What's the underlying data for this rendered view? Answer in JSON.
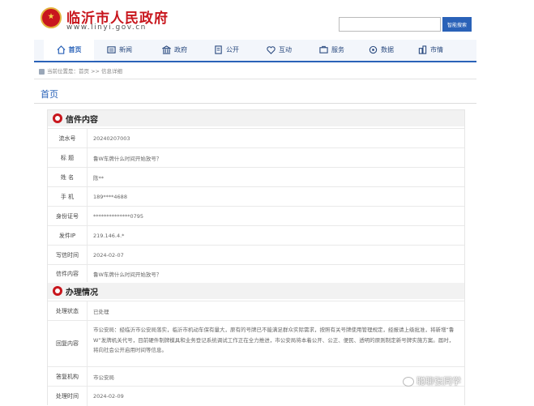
{
  "header": {
    "site_title": "临沂市人民政府",
    "site_url": "www.linyi.gov.cn",
    "search_placeholder": "",
    "search_button": "智能搜索"
  },
  "nav": [
    {
      "label": "首页",
      "icon": "home-icon"
    },
    {
      "label": "新闻",
      "icon": "news-icon"
    },
    {
      "label": "政府",
      "icon": "government-icon"
    },
    {
      "label": "公开",
      "icon": "document-icon"
    },
    {
      "label": "互动",
      "icon": "interaction-icon"
    },
    {
      "label": "服务",
      "icon": "service-icon"
    },
    {
      "label": "数据",
      "icon": "data-icon"
    },
    {
      "label": "市情",
      "icon": "city-icon"
    }
  ],
  "breadcrumb": {
    "prefix": "当前位置是：",
    "path": "首页  >>  信息详细"
  },
  "page_heading": "首页",
  "letter_section": {
    "title": "信件内容",
    "rows": [
      {
        "label": "流水号",
        "value": "20240207003"
      },
      {
        "label": "标    题",
        "value": "鲁W车牌什么时间开始放号？"
      },
      {
        "label": "姓    名",
        "value": "陈**"
      },
      {
        "label": "手    机",
        "value": "189****4688"
      },
      {
        "label": "身份证号",
        "value": "**************0795"
      },
      {
        "label": "发件IP",
        "value": "219.146.4.*"
      },
      {
        "label": "写信时间",
        "value": "2024-02-07"
      },
      {
        "label": "信件内容",
        "value": "鲁W车牌什么时间开始放号？"
      }
    ]
  },
  "handling_section": {
    "title": "办理情况",
    "rows": [
      {
        "label": "处理状态",
        "value": "已处理"
      },
      {
        "label": "回复内容",
        "value": "市公安局：经临沂市公安局落实，临沂市机动车保有量大，原有的号牌已不能满足群众实际需求，按照有关号牌使用管理规定，经报请上级批准，将新增“鲁W”发牌机关代号，目前硬件制牌模具和业务登记系统调试工作正在全力推进，市公安局将本着公开、公正、便民、透明的原则制定新号牌实施方案。届时，将向社会公开启用时间等信息。"
      },
      {
        "label": "答复机构",
        "value": "市公安局"
      },
      {
        "label": "处理时间",
        "value": "2024-02-09"
      }
    ]
  },
  "watermark": "聪聊张同学",
  "colors": {
    "brand_red": "#c8161d",
    "nav_blue": "#2a62b8"
  }
}
